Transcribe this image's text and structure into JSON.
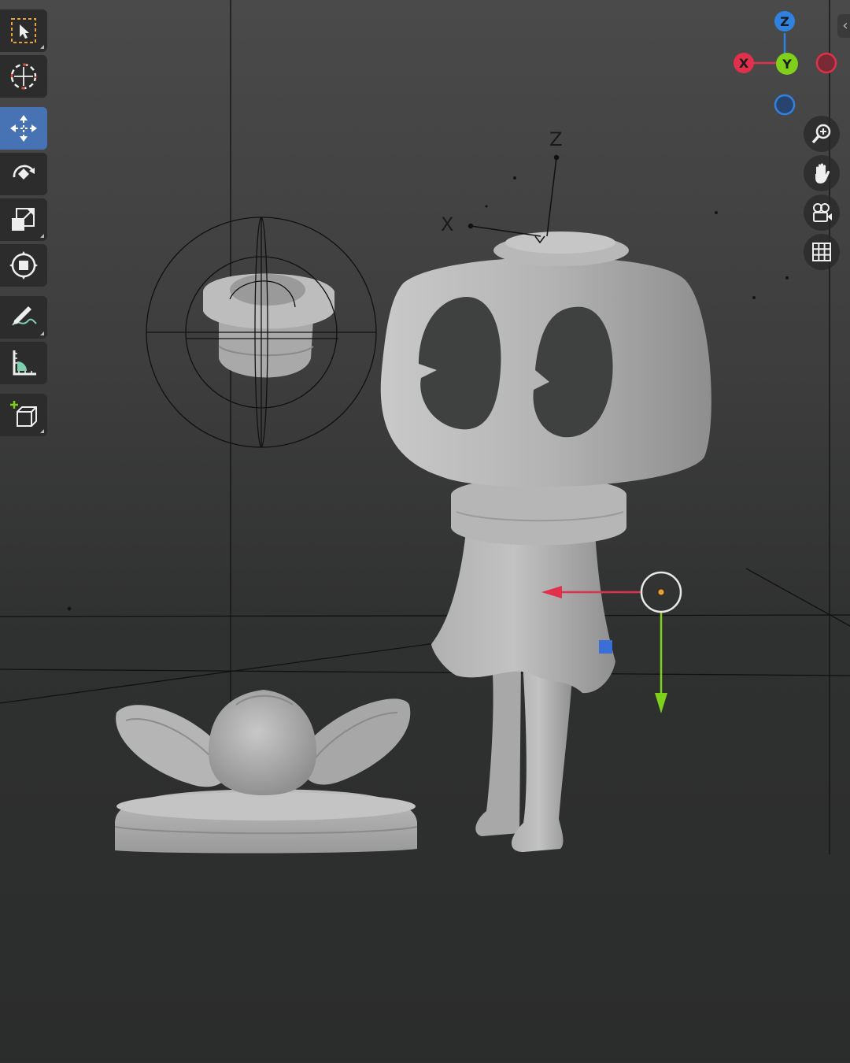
{
  "app": "3D viewport",
  "toolbar": {
    "tools": [
      {
        "name": "select-box",
        "active": false
      },
      {
        "name": "cursor",
        "active": false
      },
      {
        "name": "move",
        "active": true
      },
      {
        "name": "rotate",
        "active": false
      },
      {
        "name": "scale",
        "active": false
      },
      {
        "name": "transform",
        "active": false
      },
      {
        "name": "annotate",
        "active": false
      },
      {
        "name": "measure",
        "active": false
      },
      {
        "name": "add-cube",
        "active": false
      }
    ]
  },
  "gizmo": {
    "x_label": "X",
    "y_label": "Y",
    "z_label": "Z",
    "colors": {
      "x": "#e0304c",
      "y": "#7fd01a",
      "z": "#2f82e0",
      "neg_z": "#2a5ca8"
    }
  },
  "nav": {
    "zoom_icon": "zoom-icon",
    "pan_icon": "hand-icon",
    "camera_icon": "camera-icon",
    "grid_icon": "grid-icon",
    "collapse_glyph": "‹"
  },
  "object_axes": {
    "z_label": "Z",
    "x_label": "X"
  },
  "colors": {
    "accent": "#4772b3",
    "model": "#a9a9a9",
    "transform_x": "#e0304c",
    "transform_y": "#7fd01a"
  }
}
